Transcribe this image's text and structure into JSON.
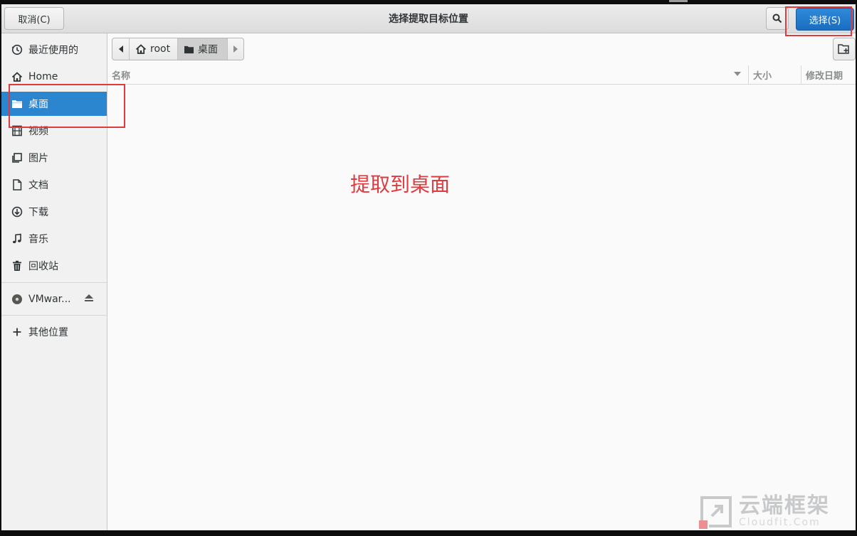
{
  "dialog": {
    "title": "选择提取目标位置",
    "cancel_label": "取消(C)",
    "select_label": "选择(S)"
  },
  "sidebar": {
    "items": [
      {
        "label": "最近使用的",
        "icon": "recent-icon"
      },
      {
        "label": "Home",
        "icon": "home-icon"
      },
      {
        "label": "桌面",
        "icon": "folder-icon",
        "active": true
      },
      {
        "label": "视频",
        "icon": "video-icon"
      },
      {
        "label": "图片",
        "icon": "image-icon"
      },
      {
        "label": "文档",
        "icon": "document-icon"
      },
      {
        "label": "下载",
        "icon": "download-icon"
      },
      {
        "label": "音乐",
        "icon": "music-icon"
      },
      {
        "label": "回收站",
        "icon": "trash-icon"
      }
    ],
    "volume": {
      "label": "VMwar...",
      "icon": "disc-icon"
    },
    "other": {
      "label": "其他位置",
      "icon": "plus-icon"
    }
  },
  "pathbar": {
    "segments": [
      {
        "label": "root",
        "icon": "home-icon"
      },
      {
        "label": "桌面",
        "icon": "folder-icon",
        "active": true
      }
    ]
  },
  "columns": {
    "name": "名称",
    "size": "大小",
    "modified": "修改日期"
  },
  "annotation": {
    "text": "提取到桌面",
    "color": "#e0393e"
  },
  "watermark": {
    "name": "云端框架",
    "url": "Cloudfit.Com"
  },
  "colors": {
    "accent": "#2b86cf",
    "highlight": "#e0393e"
  }
}
